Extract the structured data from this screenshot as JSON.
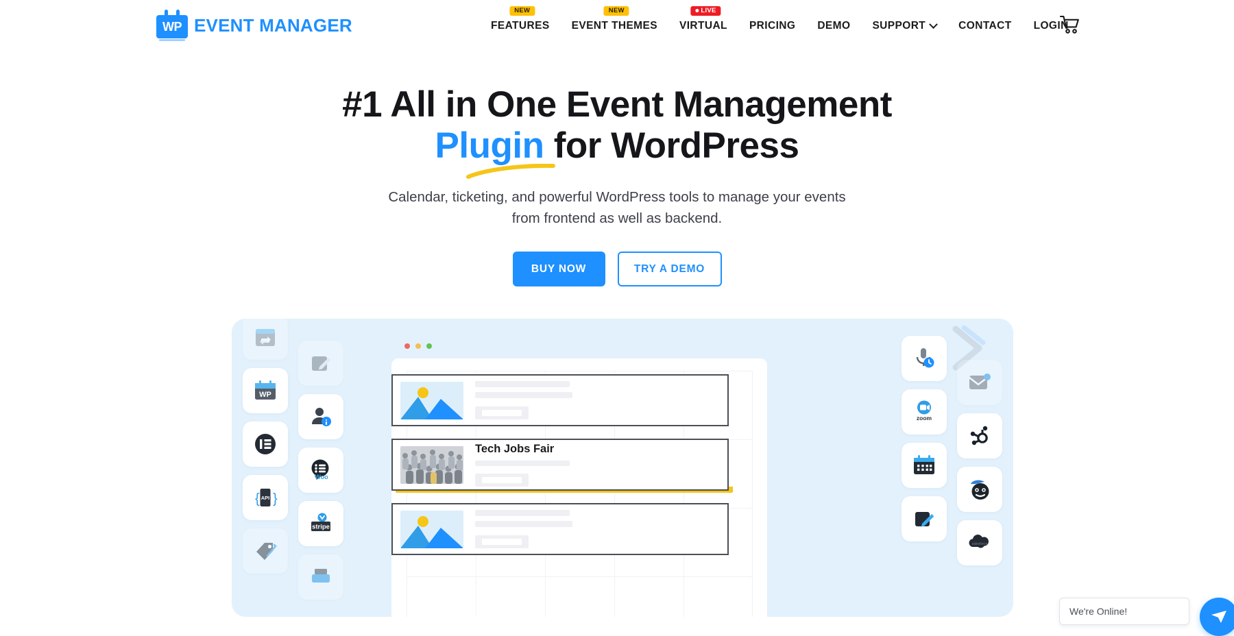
{
  "header": {
    "logo": {
      "mark_text": "WP",
      "text": "EVENT MANAGER"
    },
    "nav_items": [
      {
        "label": "FEATURES",
        "badge": "NEW",
        "badge_type": "new",
        "has_dropdown": false
      },
      {
        "label": "EVENT THEMES",
        "badge": "NEW",
        "badge_type": "new",
        "has_dropdown": false
      },
      {
        "label": "VIRTUAL",
        "badge": "LIVE",
        "badge_type": "live",
        "has_dropdown": false
      },
      {
        "label": "PRICING",
        "badge": "",
        "badge_type": "",
        "has_dropdown": false
      },
      {
        "label": "DEMO",
        "badge": "",
        "badge_type": "",
        "has_dropdown": false
      },
      {
        "label": "SUPPORT",
        "badge": "",
        "badge_type": "",
        "has_dropdown": true
      },
      {
        "label": "CONTACT",
        "badge": "",
        "badge_type": "",
        "has_dropdown": false
      },
      {
        "label": "LOGIN",
        "badge": "",
        "badge_type": "",
        "has_dropdown": false
      }
    ],
    "cart_icon": "shopping-cart-icon"
  },
  "hero": {
    "title_line1": "#1 All in One Event Management",
    "title_highlight": "Plugin",
    "title_line2_rest": " for WordPress",
    "subtitle_line1": "Calendar, ticketing, and powerful WordPress tools to manage your events",
    "subtitle_line2": "from frontend as well as backend.",
    "buttons": [
      {
        "label": "BUY NOW",
        "style": "primary"
      },
      {
        "label": "TRY A DEMO",
        "style": "ghost"
      }
    ]
  },
  "illustration": {
    "panel_color": "#e3f1fc",
    "left_column_1_icons": [
      "recurring-calendar-icon",
      "wp-calendar-icon",
      "elementor-icon",
      "api-icon",
      "tag-icon"
    ],
    "left_column_2_icons": [
      "edit-note-icon",
      "user-info-icon",
      "woocommerce-icon",
      "stripe-icon",
      "printer-icon"
    ],
    "right_column_1_icons": [
      "microphone-time-icon",
      "zoom-icon",
      "calendar-icon",
      "edit-pen-icon"
    ],
    "right_column_2_icons": [
      "email-notification-icon",
      "hubspot-icon",
      "mailchimp-icon",
      "salesforce-icon"
    ],
    "zoom_label": "zoom",
    "stripe_label": "stripe",
    "woo_label": "Woo",
    "api_label": "API",
    "wp_label": "WP",
    "salesforce_label": "salesforce",
    "browser": {
      "window_dots": [
        "#ed6a5e",
        "#f5bf4f",
        "#61c454"
      ],
      "event_rows": [
        {
          "title": "",
          "thumb": "placeholder-image",
          "skeleton": true
        },
        {
          "title": "Tech Jobs Fair",
          "thumb": "crowd-photo",
          "skeleton": false,
          "highlighted": true
        },
        {
          "title": "",
          "thumb": "placeholder-image",
          "skeleton": true
        }
      ]
    }
  },
  "chat": {
    "message": "We're Online!",
    "fab_icon": "chat-icon"
  },
  "colors": {
    "brand_blue": "#1e90ff",
    "badge_new": "#ffc107",
    "badge_live": "#ee1d24",
    "highlight_yellow": "#f5c518",
    "panel_blue": "#e3f1fc",
    "text_dark": "#15161a"
  }
}
